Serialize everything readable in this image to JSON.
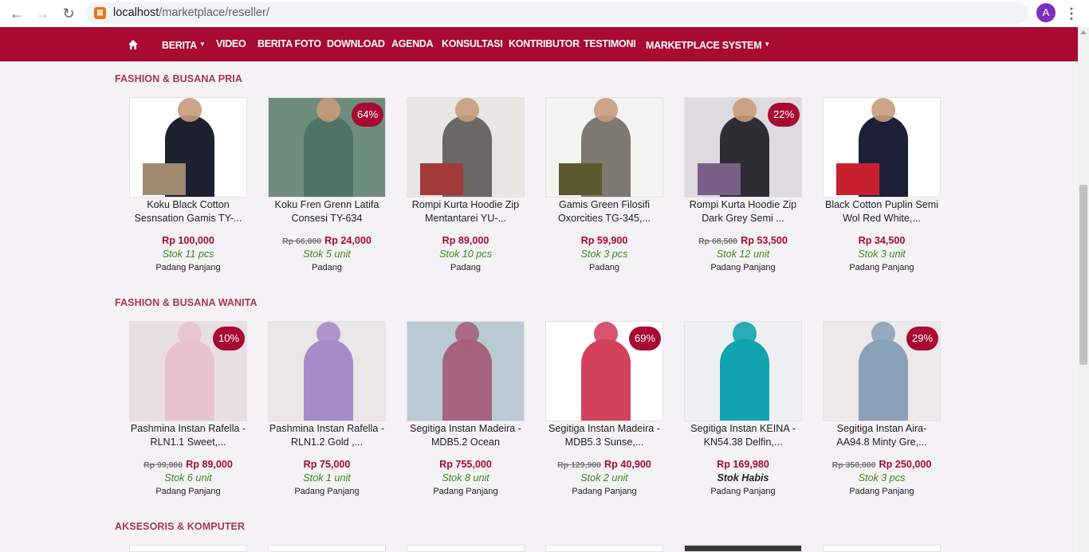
{
  "browser": {
    "url_host": "localhost",
    "url_path": "/marketplace/reseller/",
    "avatar_letter": "A"
  },
  "nav": {
    "items": [
      {
        "label": "BERITA",
        "caret": true
      },
      {
        "label": "VIDEO",
        "caret": false
      },
      {
        "label": "BERITA FOTO",
        "caret": false
      },
      {
        "label": "DOWNLOAD",
        "caret": false
      },
      {
        "label": "AGENDA",
        "caret": false
      },
      {
        "label": "KONSULTASI",
        "caret": false
      },
      {
        "label": "KONTRIBUTOR",
        "caret": false
      },
      {
        "label": "TESTIMONI",
        "caret": false
      },
      {
        "label": "MARKETPLACE SYSTEM",
        "caret": true
      }
    ]
  },
  "colors": {
    "brand": "#a80a32",
    "stock_green": "#3a8a18",
    "section_title": "#a8384c"
  },
  "sections": [
    {
      "title": "FASHION & BUSANA PRIA",
      "products": [
        {
          "name": "Koku Black Cotton Sesnsation Gamis TY-...",
          "old_price": "",
          "price": "Rp 100,000",
          "stock": "Stok 11 pcs",
          "city": "Padang Panjang",
          "badge": ""
        },
        {
          "name": "Koku Fren Grenn Latifa Consesi TY-634",
          "old_price": "Rp 66,000",
          "price": "Rp 24,000",
          "stock": "Stok 5 unit",
          "city": "Padang",
          "badge": "64%"
        },
        {
          "name": "Rompi Kurta Hoodie Zip Mentantarei YU-...",
          "old_price": "",
          "price": "Rp 89,000",
          "stock": "Stok 10 pcs",
          "city": "Padang",
          "badge": ""
        },
        {
          "name": "Gamis Green Filosifi Oxorcities TG-345,...",
          "old_price": "",
          "price": "Rp 59,900",
          "stock": "Stok 3 pcs",
          "city": "Padang",
          "badge": ""
        },
        {
          "name": "Rompi Kurta Hoodie Zip Dark Grey Semi ...",
          "old_price": "Rp 68,500",
          "price": "Rp 53,500",
          "stock": "Stok 12 unit",
          "city": "Padang Panjang",
          "badge": "22%"
        },
        {
          "name": "Black Cotton Puplin Semi Wol Red White,...",
          "old_price": "",
          "price": "Rp 34,500",
          "stock": "Stok 3 unit",
          "city": "Padang Panjang",
          "badge": ""
        }
      ]
    },
    {
      "title": "FASHION & BUSANA WANITA",
      "products": [
        {
          "name": "Pashmina Instan Rafella - RLN1.1 Sweet,...",
          "old_price": "Rp 99,000",
          "price": "Rp 89,000",
          "stock": "Stok 6 unit",
          "city": "Padang Panjang",
          "badge": "10%"
        },
        {
          "name": "Pashmina Instan Rafella - RLN1.2 Gold ,...",
          "old_price": "",
          "price": "Rp 75,000",
          "stock": "Stok 1 unit",
          "city": "Padang Panjang",
          "badge": ""
        },
        {
          "name": "Segitiga Instan Madeira - MDB5.2 Ocean",
          "old_price": "",
          "price": "Rp 755,000",
          "stock": "Stok 8 unit",
          "city": "Padang Panjang",
          "badge": ""
        },
        {
          "name": "Segitiga Instan Madeira - MDB5.3 Sunse,...",
          "old_price": "Rp 129,900",
          "price": "Rp 40,900",
          "stock": "Stok 2 unit",
          "city": "Padang Panjang",
          "badge": "69%"
        },
        {
          "name": "Segitiga Instan KEINA - KN54.38 Delfin,...",
          "old_price": "",
          "price": "Rp 169,980",
          "stock": "Stok Habis",
          "city": "Padang Panjang",
          "badge": ""
        },
        {
          "name": "Segitiga Instan Aira- AA94.8 Minty Gre,...",
          "old_price": "Rp 350,000",
          "price": "Rp 250,000",
          "stock": "Stok 3 pcs",
          "city": "Padang Panjang",
          "badge": "29%"
        }
      ]
    },
    {
      "title": "AKSESORIS & KOMPUTER",
      "products": []
    }
  ]
}
